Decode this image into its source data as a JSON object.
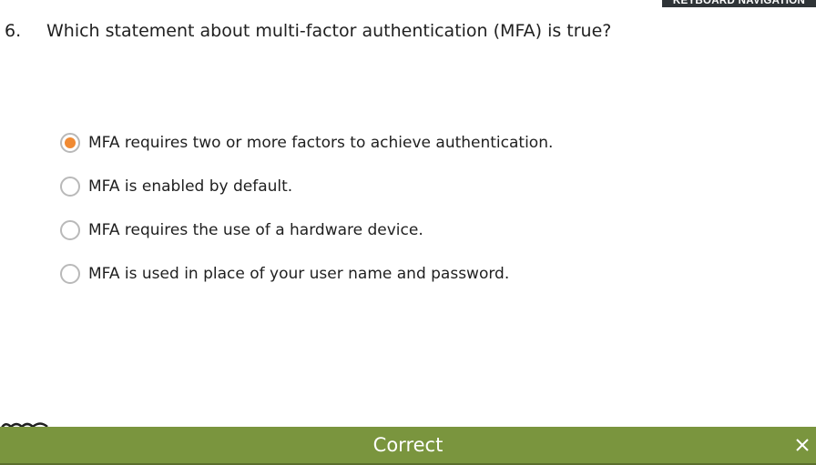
{
  "keyboard_navigation_label": "KEYBOARD NAVIGATION",
  "question": {
    "number": "6.",
    "text": "Which statement about multi-factor authentication (MFA) is true?"
  },
  "options": [
    {
      "label": "MFA requires two or more factors to achieve authentication.",
      "selected": true
    },
    {
      "label": "MFA is enabled by default.",
      "selected": false
    },
    {
      "label": "MFA requires the use of a hardware device.",
      "selected": false
    },
    {
      "label": "MFA is used in place of your user name and password.",
      "selected": false
    }
  ],
  "result": {
    "label": "Correct",
    "icon": "close-icon"
  },
  "colors": {
    "selected_radio": "#f08a33",
    "result_bar": "#7a953e",
    "keyboard_nav_bg": "#2f3437"
  }
}
